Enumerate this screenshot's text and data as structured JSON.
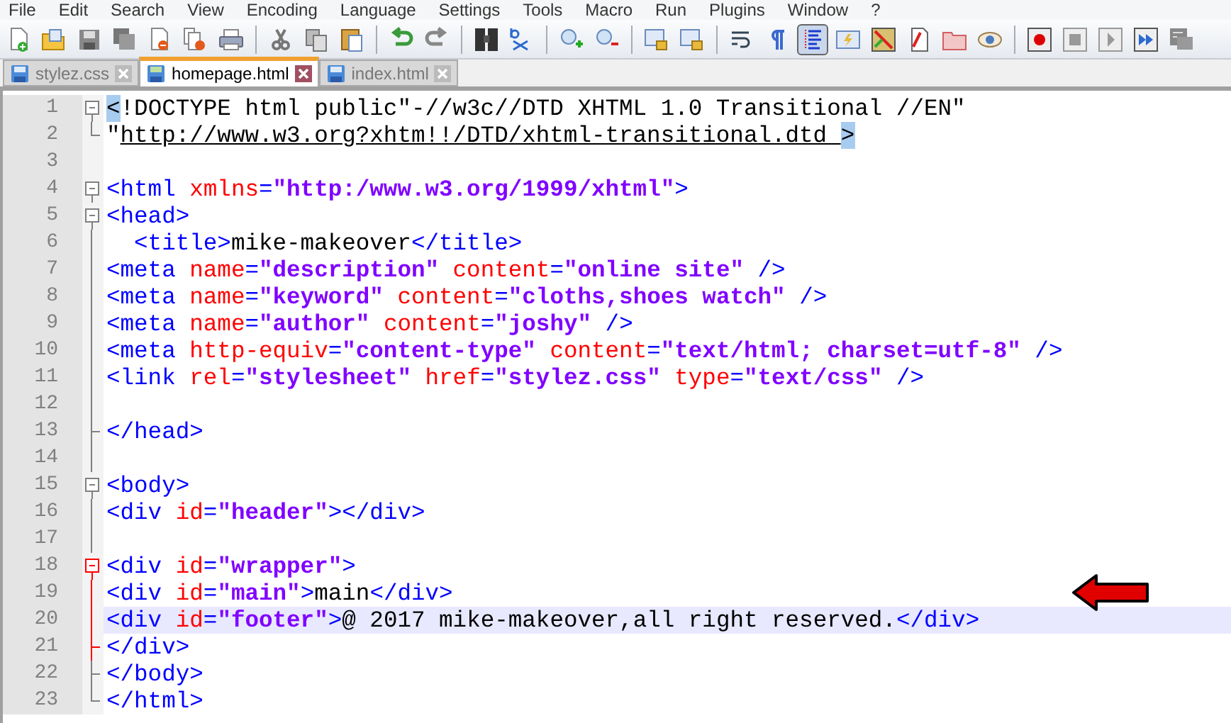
{
  "menu": [
    "File",
    "Edit",
    "Search",
    "View",
    "Encoding",
    "Language",
    "Settings",
    "Tools",
    "Macro",
    "Run",
    "Plugins",
    "Window",
    "?"
  ],
  "toolbar": [
    {
      "kind": "new",
      "pressed": false
    },
    {
      "kind": "open",
      "pressed": false
    },
    {
      "kind": "save",
      "pressed": false
    },
    {
      "kind": "save-all",
      "pressed": false
    },
    {
      "kind": "close",
      "pressed": false
    },
    {
      "kind": "close-all",
      "pressed": false
    },
    {
      "kind": "print",
      "pressed": false
    },
    {
      "kind": "sep"
    },
    {
      "kind": "cut",
      "pressed": false
    },
    {
      "kind": "copy",
      "pressed": false
    },
    {
      "kind": "paste",
      "pressed": false
    },
    {
      "kind": "sep"
    },
    {
      "kind": "undo",
      "pressed": false
    },
    {
      "kind": "redo",
      "pressed": false
    },
    {
      "kind": "sep"
    },
    {
      "kind": "find",
      "pressed": false
    },
    {
      "kind": "replace",
      "pressed": false
    },
    {
      "kind": "sep"
    },
    {
      "kind": "zoom-in",
      "pressed": false
    },
    {
      "kind": "zoom-out",
      "pressed": false
    },
    {
      "kind": "sep"
    },
    {
      "kind": "sync-v",
      "pressed": false
    },
    {
      "kind": "sync-h",
      "pressed": false
    },
    {
      "kind": "sep"
    },
    {
      "kind": "wrap",
      "pressed": false
    },
    {
      "kind": "pilcrow",
      "pressed": false
    },
    {
      "kind": "indent-guide",
      "pressed": true
    },
    {
      "kind": "lang",
      "pressed": false
    },
    {
      "kind": "map",
      "pressed": false
    },
    {
      "kind": "function",
      "pressed": false
    },
    {
      "kind": "folder",
      "pressed": false
    },
    {
      "kind": "eye",
      "pressed": false
    },
    {
      "kind": "sep"
    },
    {
      "kind": "record",
      "pressed": false
    },
    {
      "kind": "stop",
      "pressed": false
    },
    {
      "kind": "play",
      "pressed": false
    },
    {
      "kind": "play-multi",
      "pressed": false
    },
    {
      "kind": "save-macro",
      "pressed": false
    }
  ],
  "tabs": [
    {
      "label": "stylez.css",
      "selected": false
    },
    {
      "label": "homepage.html",
      "selected": true
    },
    {
      "label": "index.html",
      "selected": false
    }
  ],
  "editor": {
    "lines": [
      {
        "number": "1",
        "kind": "fold-open",
        "active": false,
        "current": false,
        "tokens": [
          {
            "kind": "match",
            "text": "<"
          },
          {
            "kind": "text",
            "text": "!DOCTYPE html public\"-//w3c//DTD XHTML 1.0 Transitional //EN\""
          }
        ]
      },
      {
        "number": "2",
        "kind": "fold-end",
        "active": false,
        "current": false,
        "tokens": [
          {
            "kind": "text",
            "text": "\""
          },
          {
            "kind": "link",
            "text": "http://www.w3.org?xhtm!!/DTD/xhtml-transitional.dtd "
          },
          {
            "kind": "match",
            "text": ">"
          }
        ]
      },
      {
        "number": "3",
        "kind": "plain",
        "current": false
      },
      {
        "number": "4",
        "kind": "fold-open",
        "active": false,
        "current": false,
        "tokens": [
          {
            "kind": "tag",
            "text": "<html"
          },
          {
            "kind": "attr",
            "text": " xmlns"
          },
          {
            "kind": "tag",
            "text": "="
          },
          {
            "kind": "value",
            "text": "\"http:/www.w3.org/1999/xhtml\""
          },
          {
            "kind": "tag",
            "text": ">"
          }
        ]
      },
      {
        "number": "5",
        "kind": "fold-open",
        "active": false,
        "current": false,
        "tokens": [
          {
            "kind": "tag",
            "text": "<head>"
          }
        ]
      },
      {
        "number": "6",
        "kind": "fold-line",
        "active": false,
        "current": false,
        "tokens": [
          {
            "kind": "tag",
            "text": "  <title>"
          },
          {
            "kind": "text",
            "text": "mike-makeover"
          },
          {
            "kind": "tag",
            "text": "</title>"
          }
        ]
      },
      {
        "number": "7",
        "kind": "fold-line",
        "active": false,
        "current": false,
        "tokens": [
          {
            "kind": "tag",
            "text": "<meta"
          },
          {
            "kind": "attr",
            "text": " name"
          },
          {
            "kind": "tag",
            "text": "="
          },
          {
            "kind": "value",
            "text": "\"description\""
          },
          {
            "kind": "attr",
            "text": " content"
          },
          {
            "kind": "tag",
            "text": "="
          },
          {
            "kind": "value",
            "text": "\"online site\""
          },
          {
            "kind": "tag",
            "text": " />"
          }
        ]
      },
      {
        "number": "8",
        "kind": "fold-line",
        "active": false,
        "current": false,
        "tokens": [
          {
            "kind": "tag",
            "text": "<meta"
          },
          {
            "kind": "attr",
            "text": " name"
          },
          {
            "kind": "tag",
            "text": "="
          },
          {
            "kind": "value",
            "text": "\"keyword\""
          },
          {
            "kind": "attr",
            "text": " content"
          },
          {
            "kind": "tag",
            "text": "="
          },
          {
            "kind": "value",
            "text": "\"cloths,shoes watch\""
          },
          {
            "kind": "tag",
            "text": " />"
          }
        ]
      },
      {
        "number": "9",
        "kind": "fold-line",
        "active": false,
        "current": false,
        "tokens": [
          {
            "kind": "tag",
            "text": "<meta"
          },
          {
            "kind": "attr",
            "text": " name"
          },
          {
            "kind": "tag",
            "text": "="
          },
          {
            "kind": "value",
            "text": "\"author\""
          },
          {
            "kind": "attr",
            "text": " content"
          },
          {
            "kind": "tag",
            "text": "="
          },
          {
            "kind": "value",
            "text": "\"joshy\""
          },
          {
            "kind": "tag",
            "text": " />"
          }
        ]
      },
      {
        "number": "10",
        "kind": "fold-line",
        "active": false,
        "current": false,
        "tokens": [
          {
            "kind": "tag",
            "text": "<meta"
          },
          {
            "kind": "attr",
            "text": " http-equiv"
          },
          {
            "kind": "tag",
            "text": "="
          },
          {
            "kind": "value",
            "text": "\"content-type\""
          },
          {
            "kind": "attr",
            "text": " content"
          },
          {
            "kind": "tag",
            "text": "="
          },
          {
            "kind": "value",
            "text": "\"text/html; charset=utf-8\""
          },
          {
            "kind": "tag",
            "text": " />"
          }
        ]
      },
      {
        "number": "11",
        "kind": "fold-line",
        "active": false,
        "current": false,
        "tokens": [
          {
            "kind": "tag",
            "text": "<link"
          },
          {
            "kind": "attr",
            "text": " rel"
          },
          {
            "kind": "tag",
            "text": "="
          },
          {
            "kind": "value",
            "text": "\"stylesheet\""
          },
          {
            "kind": "attr",
            "text": " href"
          },
          {
            "kind": "tag",
            "text": "="
          },
          {
            "kind": "value",
            "text": "\"stylez.css\""
          },
          {
            "kind": "attr",
            "text": " type"
          },
          {
            "kind": "tag",
            "text": "="
          },
          {
            "kind": "value",
            "text": "\"text/css\""
          },
          {
            "kind": "tag",
            "text": " />"
          }
        ]
      },
      {
        "number": "12",
        "kind": "fold-line",
        "active": false,
        "current": false
      },
      {
        "number": "13",
        "kind": "fold-tee",
        "active": false,
        "current": false,
        "tokens": [
          {
            "kind": "tag",
            "text": "</head>"
          }
        ]
      },
      {
        "number": "14",
        "kind": "fold-line",
        "active": false,
        "current": false
      },
      {
        "number": "15",
        "kind": "fold-open",
        "active": false,
        "current": false,
        "tokens": [
          {
            "kind": "tag",
            "text": "<body>"
          }
        ]
      },
      {
        "number": "16",
        "kind": "fold-line",
        "active": false,
        "current": false,
        "tokens": [
          {
            "kind": "tag",
            "text": "<div"
          },
          {
            "kind": "attr",
            "text": " id"
          },
          {
            "kind": "tag",
            "text": "="
          },
          {
            "kind": "value",
            "text": "\"header\""
          },
          {
            "kind": "tag",
            "text": "></div>"
          }
        ]
      },
      {
        "number": "17",
        "kind": "fold-line",
        "active": false,
        "current": false
      },
      {
        "number": "18",
        "kind": "fold-open",
        "active": true,
        "current": false,
        "tokens": [
          {
            "kind": "tag",
            "text": "<div"
          },
          {
            "kind": "attr",
            "text": " id"
          },
          {
            "kind": "tag",
            "text": "="
          },
          {
            "kind": "value",
            "text": "\"wrapper\""
          },
          {
            "kind": "tag",
            "text": ">"
          }
        ]
      },
      {
        "number": "19",
        "kind": "fold-line",
        "active": true,
        "current": false,
        "tokens": [
          {
            "kind": "tag",
            "text": "<div"
          },
          {
            "kind": "attr",
            "text": " id"
          },
          {
            "kind": "tag",
            "text": "="
          },
          {
            "kind": "value",
            "text": "\"main\""
          },
          {
            "kind": "tag",
            "text": ">"
          },
          {
            "kind": "text",
            "text": "main"
          },
          {
            "kind": "tag",
            "text": "</div>"
          }
        ]
      },
      {
        "number": "20",
        "kind": "fold-line",
        "active": true,
        "current": true,
        "tokens": [
          {
            "kind": "tag",
            "text": "<div"
          },
          {
            "kind": "attr",
            "text": " id"
          },
          {
            "kind": "tag",
            "text": "="
          },
          {
            "kind": "value",
            "text": "\"footer\""
          },
          {
            "kind": "tag",
            "text": ">"
          },
          {
            "kind": "text",
            "text": "@ 2017 mike-makeover,all right reserved."
          },
          {
            "kind": "tag",
            "text": "</div>"
          }
        ]
      },
      {
        "number": "21",
        "kind": "fold-tee",
        "active": true,
        "current": false,
        "tokens": [
          {
            "kind": "tag",
            "text": "</div>"
          }
        ]
      },
      {
        "number": "22",
        "kind": "fold-tee",
        "active": false,
        "current": false,
        "tokens": [
          {
            "kind": "tag",
            "text": "</body>"
          }
        ]
      },
      {
        "number": "23",
        "kind": "fold-end",
        "active": false,
        "current": false,
        "tokens": [
          {
            "kind": "tag",
            "text": "</html>"
          }
        ]
      }
    ]
  }
}
